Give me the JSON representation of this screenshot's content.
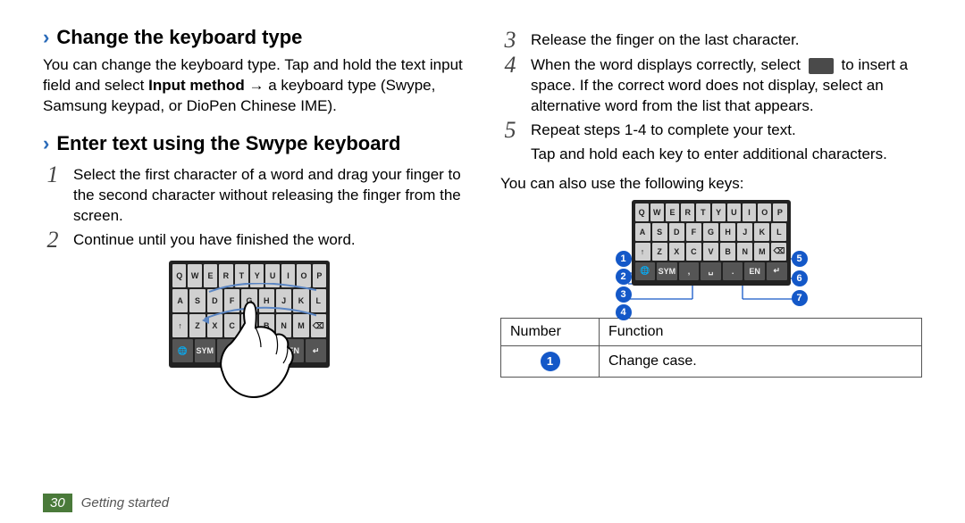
{
  "left": {
    "heading1": "Change the keyboard type",
    "para1_a": "You can change the keyboard type. Tap and hold the text input field and select ",
    "para1_b": "Input method",
    "para1_c": " → a keyboard type (Swype, Samsung keypad, or DioPen Chinese IME).",
    "heading2": "Enter text using the Swype keyboard",
    "steps": [
      "Select the first character of a word and drag your finger to the second character without releasing the finger from the screen.",
      "Continue until you have finished the word."
    ],
    "keyboard_layout": {
      "row1": [
        "Q",
        "W",
        "E",
        "R",
        "T",
        "Y",
        "U",
        "I",
        "O",
        "P"
      ],
      "row2": [
        "A",
        "S",
        "D",
        "F",
        "G",
        "H",
        "J",
        "K",
        "L"
      ],
      "row3": [
        "↑",
        "Z",
        "X",
        "C",
        "V",
        "B",
        "N",
        "M",
        "⌫"
      ],
      "row4": [
        "🌐",
        "SYM",
        ",",
        "␣",
        ".",
        "EN",
        "↵"
      ]
    }
  },
  "right": {
    "steps": [
      {
        "text": "Release the finger on the last character.",
        "sub": ""
      },
      {
        "text": "When the word displays correctly, select ␣ to insert a space. If the correct word does not display, select an alternative word from the list that appears.",
        "sub": ""
      },
      {
        "text": "Repeat steps 1-4 to complete your text.",
        "sub": "Tap and hold each key to enter additional characters."
      }
    ],
    "start_num": 3,
    "note": "You can also use the following keys:",
    "callouts_left": [
      "1",
      "2",
      "3",
      "4"
    ],
    "callouts_right": [
      "5",
      "6",
      "7"
    ],
    "table": {
      "header_num": "Number",
      "header_func": "Function",
      "rows": [
        {
          "num": "1",
          "func": "Change case."
        }
      ]
    }
  },
  "footer": {
    "page": "30",
    "section": "Getting started"
  }
}
